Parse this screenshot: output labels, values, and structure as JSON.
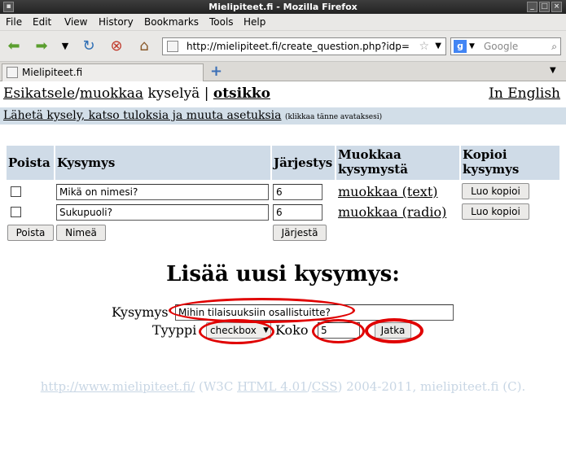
{
  "window": {
    "title": "Mielipiteet.fi - Mozilla Firefox"
  },
  "menu": [
    "File",
    "Edit",
    "View",
    "History",
    "Bookmarks",
    "Tools",
    "Help"
  ],
  "nav": {
    "url": "http://mielipiteet.fi/create_question.php?idp=",
    "search_placeholder": "Google"
  },
  "tab": {
    "title": "Mielipiteet.fi",
    "new_tab": "+"
  },
  "page": {
    "heading_part1": "Esikatsele",
    "heading_sep": "/",
    "heading_part2": "muokkaa",
    "heading_part3": " kyselyä | ",
    "heading_bold": "otsikko",
    "english_link": "In English",
    "banner_link": "Lähetä kysely, katso tuloksia ja muuta asetuksia",
    "banner_note": "(klikkaa tänne avataksesi)"
  },
  "table": {
    "headers": {
      "delete": "Poista",
      "question": "Kysymys",
      "order": "Järjestys",
      "edit": "Muokkaa kysymystä",
      "copy": "Kopioi kysymys"
    },
    "rows": [
      {
        "question": "Mikä on nimesi?",
        "order": "6",
        "edit_link": "muokkaa (text)",
        "copy_button": "Luo kopioi"
      },
      {
        "question": "Sukupuoli?",
        "order": "6",
        "edit_link": "muokkaa (radio)",
        "copy_button": "Luo kopioi"
      }
    ],
    "buttons": {
      "delete": "Poista",
      "rename": "Nimeä",
      "reorder": "Järjestä"
    }
  },
  "add_question": {
    "title": "Lisää uusi kysymys:",
    "question_label": "Kysymys",
    "question_value": "Mihin tilaisuuksiin osallistuitte?",
    "type_label": "Tyyppi",
    "type_value": "checkbox",
    "size_label": "Koko",
    "size_value": "5",
    "submit": "Jatka"
  },
  "footer": {
    "link1": "http://www.mielipiteet.fi/",
    "text1": " (W3C ",
    "link2": "HTML 4.01",
    "sep": "/",
    "link3": "CSS",
    "text2": ") 2004-2011, mielipiteet.fi (C)."
  },
  "colors": {
    "header_bg": "#cfdbe7",
    "banner_bg": "#d2dee8",
    "highlight": "#e00000",
    "footer_text": "#c8d6e4"
  }
}
